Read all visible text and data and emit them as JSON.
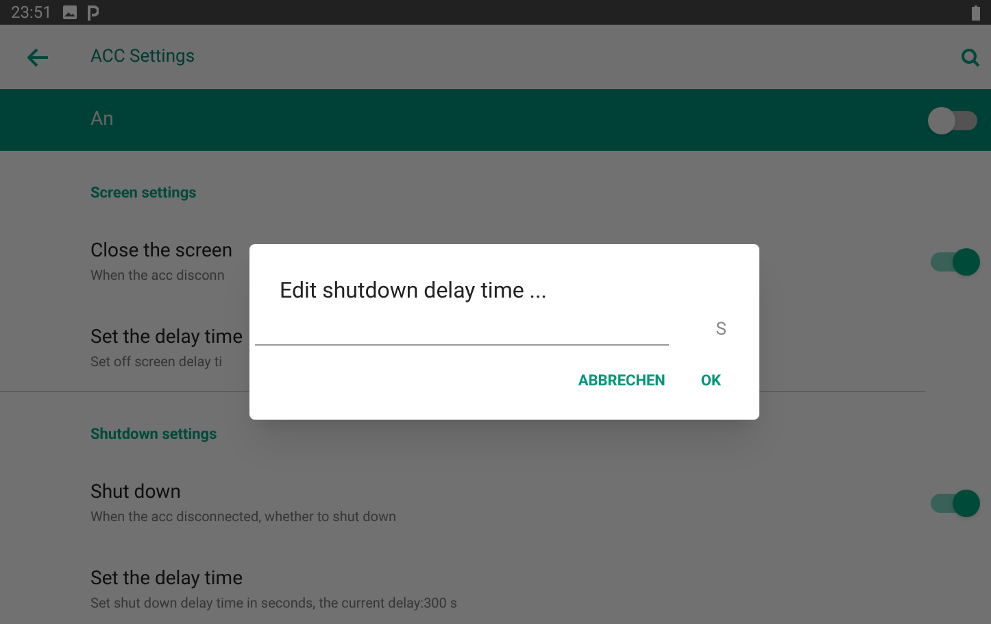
{
  "status_bar": {
    "time": "23:51"
  },
  "toolbar": {
    "title": "ACC Settings"
  },
  "master_switch": {
    "label": "An",
    "on": false
  },
  "sections": [
    {
      "header": "Screen settings",
      "items": [
        {
          "kind": "switch",
          "title": "Close the screen",
          "summary": "When the acc disconn",
          "on": true
        },
        {
          "kind": "plain",
          "title": "Set the delay time",
          "summary": "Set off screen delay ti"
        }
      ]
    },
    {
      "header": "Shutdown settings",
      "items": [
        {
          "kind": "switch",
          "title": "Shut down",
          "summary": "When the acc disconnected, whether to shut down",
          "on": true
        },
        {
          "kind": "plain",
          "title": "Set the delay time",
          "summary": "Set shut down delay time in seconds, the current delay:300 s"
        }
      ]
    }
  ],
  "dialog": {
    "title": "Edit shutdown delay time ...",
    "unit": "S",
    "buttons": [
      "ABBRECHEN",
      "OK"
    ]
  }
}
